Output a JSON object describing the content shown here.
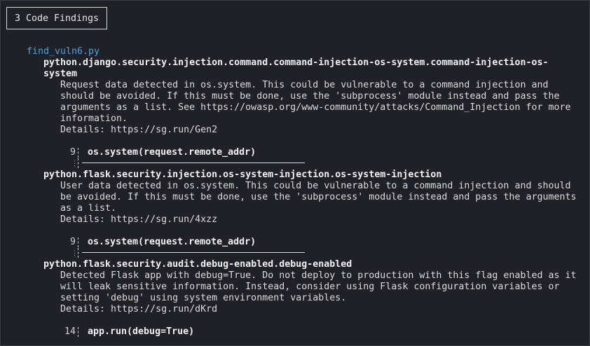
{
  "header": {
    "title": "3 Code Findings"
  },
  "file": "find_vuln6.py",
  "findings": [
    {
      "rule_lines": [
        "python.django.security.injection.command.command-injection-os-system.command-injection-os-",
        "system"
      ],
      "message_lines": [
        "Request data detected in os.system. This could be vulnerable to a command injection and",
        "should be avoided. If this must be done, use the 'subprocess' module instead and pass the",
        "arguments as a list. See https://owasp.org/www-community/attacks/Command_Injection for more",
        "information."
      ],
      "details": "Details: https://sg.run/Gen2",
      "line_number": "9",
      "code": "os.system(request.remote_addr)"
    },
    {
      "rule_lines": [
        "python.flask.security.injection.os-system-injection.os-system-injection"
      ],
      "message_lines": [
        "User data detected in os.system. This could be vulnerable to a command injection and should",
        "be avoided. If this must be done, use the 'subprocess' module instead and pass the arguments",
        "as a list."
      ],
      "details": "Details: https://sg.run/4xzz",
      "line_number": "9",
      "code": "os.system(request.remote_addr)"
    },
    {
      "rule_lines": [
        "python.flask.security.audit.debug-enabled.debug-enabled"
      ],
      "message_lines": [
        "Detected Flask app with debug=True. Do not deploy to production with this flag enabled as it",
        "will leak sensitive information. Instead, consider using Flask configuration variables or",
        "setting 'debug' using system environment variables."
      ],
      "details": "Details: https://sg.run/dKrd",
      "line_number": "14",
      "code": "app.run(debug=True)"
    }
  ]
}
